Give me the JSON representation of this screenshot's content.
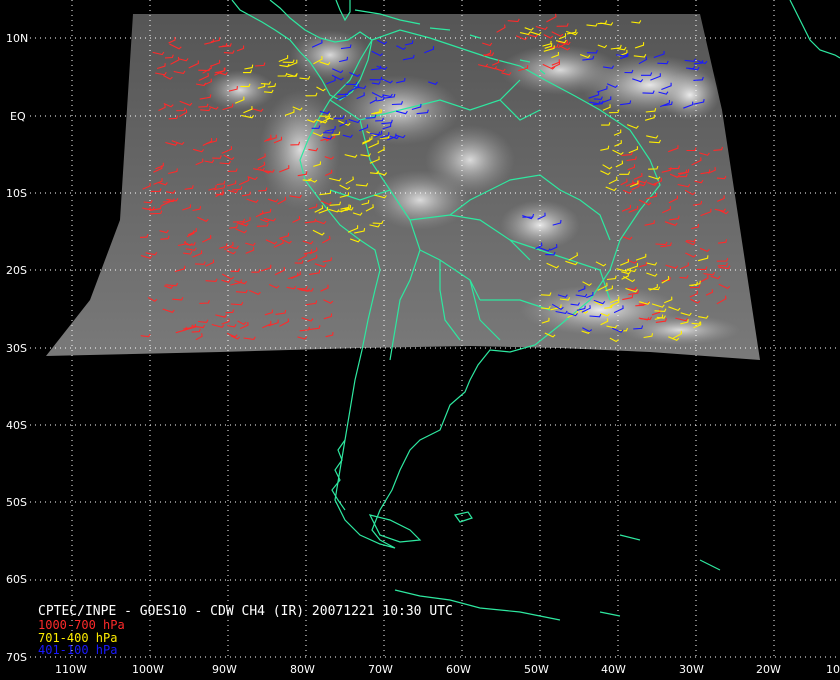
{
  "map": {
    "caption": "CPTEC/INPE - GOES10 - CDW CH4 (IR) 20071221 10:30 UTC",
    "legend": [
      {
        "label": "1000-700 hPa",
        "color": "#ff2a2a"
      },
      {
        "label": "701-400 hPa",
        "color": "#ffee00"
      },
      {
        "label": "401-100 hPa",
        "color": "#1a1aff"
      }
    ],
    "lat_labels": [
      "10N",
      "EQ",
      "10S",
      "20S",
      "30S",
      "40S",
      "50S",
      "60S",
      "70S"
    ],
    "lon_labels": [
      "110W",
      "100W",
      "90W",
      "80W",
      "70W",
      "60W",
      "50W",
      "40W",
      "30W",
      "20W",
      "10"
    ],
    "colors": {
      "background": "#000000",
      "coastline": "#2ee8a0",
      "grid": "#ffffff",
      "ir_imagery": "#6e6e6e"
    }
  }
}
